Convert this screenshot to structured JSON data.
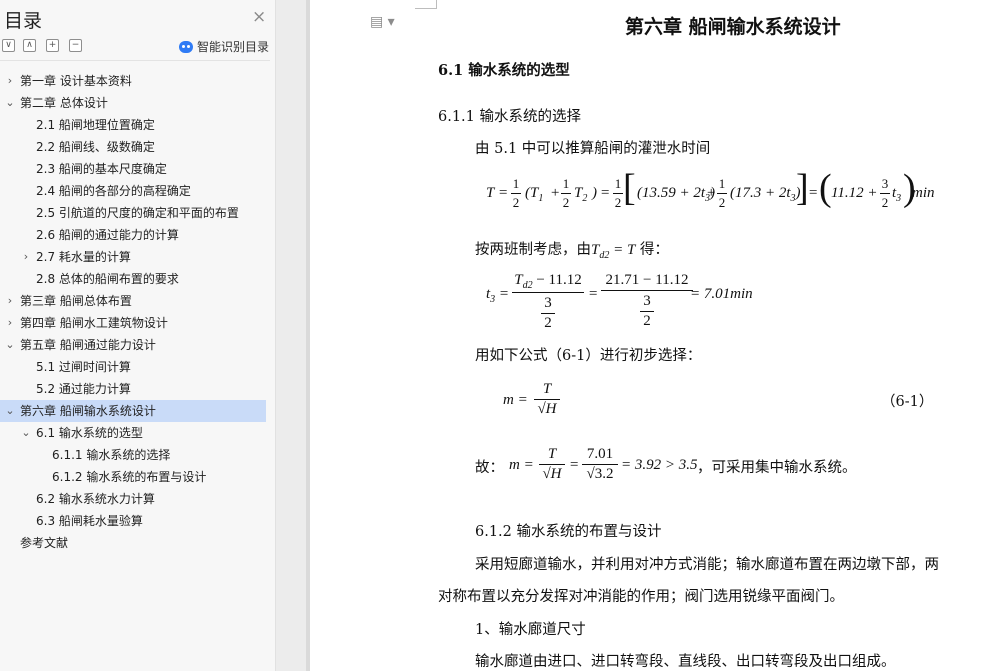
{
  "sidebar": {
    "title": "目录",
    "close_icon": "×",
    "buttons": [
      "∨",
      "∧",
      "+",
      "−"
    ],
    "smart_toc_label": "智能识别目录",
    "items": [
      {
        "text": "第一章  设计基本资料",
        "arrow": "›",
        "level": 0
      },
      {
        "text": "第二章  总体设计",
        "arrow": "⌄",
        "level": 0
      },
      {
        "text": "2.1  船闸地理位置确定",
        "arrow": "",
        "level": 1
      },
      {
        "text": "2.2  船闸线、级数确定",
        "arrow": "",
        "level": 1
      },
      {
        "text": "2.3  船闸的基本尺度确定",
        "arrow": "",
        "level": 1
      },
      {
        "text": "2.4  船闸的各部分的高程确定",
        "arrow": "",
        "level": 1
      },
      {
        "text": "2.5  引航道的尺度的确定和平面的布置",
        "arrow": "",
        "level": 1
      },
      {
        "text": "2.6  船闸的通过能力的计算",
        "arrow": "",
        "level": 1
      },
      {
        "text": "2.7  耗水量的计算",
        "arrow": "›",
        "level": 1
      },
      {
        "text": "2.8  总体的船闸布置的要求",
        "arrow": "",
        "level": 1
      },
      {
        "text": "第三章  船闸总体布置",
        "arrow": "›",
        "level": 0
      },
      {
        "text": "第四章  船闸水工建筑物设计",
        "arrow": "›",
        "level": 0
      },
      {
        "text": "第五章  船闸通过能力设计",
        "arrow": "⌄",
        "level": 0
      },
      {
        "text": "5.1 过闸时间计算",
        "arrow": "",
        "level": 1
      },
      {
        "text": "5.2 通过能力计算",
        "arrow": "",
        "level": 1
      },
      {
        "text": "第六章  船闸输水系统设计",
        "arrow": "⌄",
        "level": 0,
        "active": true
      },
      {
        "text": "6.1 输水系统的选型",
        "arrow": "⌄",
        "level": 1
      },
      {
        "text": "6.1.1 输水系统的选择",
        "arrow": "",
        "level": 2
      },
      {
        "text": "6.1.2 输水系统的布置与设计",
        "arrow": "",
        "level": 2
      },
      {
        "text": "6.2 输水系统水力计算",
        "arrow": "",
        "level": 1
      },
      {
        "text": "6.3 船闸耗水量验算",
        "arrow": "",
        "level": 1
      },
      {
        "text": "参考文献",
        "arrow": "",
        "level": 0
      }
    ]
  },
  "document": {
    "page_icon": "▤ ▾",
    "chapter_title": "第六章  船闸输水系统设计",
    "section_61": "6.1 输水系统的选型",
    "section_611": "6.1.1 输水系统的选择",
    "para1": "由 5.1 中可以推算船闸的灌泄水时间",
    "eq1": {
      "lhs": "T",
      "half": [
        "1",
        "2"
      ],
      "t1": "(T",
      "t1sub": "1",
      "plus": "+",
      "t2": "T",
      "t2sub": "2",
      "close": ")",
      "eq": "=",
      "inner1": "(13.59 + 2",
      "t3": "t",
      "t3sub": "3",
      "inner2": "(17.3 + 2",
      "eq2": "=",
      "res1": "11.12 +",
      "three_half": [
        "3",
        "2"
      ],
      "unit": "min"
    },
    "para2_a": "按两班制考虑，由",
    "para2_td": "T",
    "para2_tdsub": "d2",
    "para2_eq": " = T",
    "para2_b": " 得：",
    "eq2": {
      "lhs": "t",
      "lhssub": "3",
      "num1": "T",
      "num1sub": "d2",
      "num1rest": " − 11.12",
      "den1": "3",
      "den1b": "2",
      "num2": "21.71 − 11.12",
      "den2": "3",
      "den2b": "2",
      "result": "= 7.01min"
    },
    "para3": "用如下公式（6-1）进行初步选择：",
    "eq3": {
      "lhs": "m =",
      "num": "T",
      "den": "√H",
      "tag": "（6-1）"
    },
    "para4_a": "故：",
    "eq4": {
      "lhs": "m =",
      "num1": "T",
      "den1": "√H",
      "num2": "7.01",
      "den2": "√3.2",
      "result": "= 3.92 > 3.5"
    },
    "para4_b": "，可采用集中输水系统。",
    "section_612": "6.1.2 输水系统的布置与设计",
    "para5": "采用短廊道输水，并利用对冲方式消能；输水廊道布置在两边墩下部，两",
    "para6": "对称布置以充分发挥对冲消能的作用；阀门选用锐缘平面阀门。",
    "para7": "1、输水廊道尺寸",
    "para8": "输水廊道由进口、进口转弯段、直线段、出口转弯段及出口组成。"
  }
}
